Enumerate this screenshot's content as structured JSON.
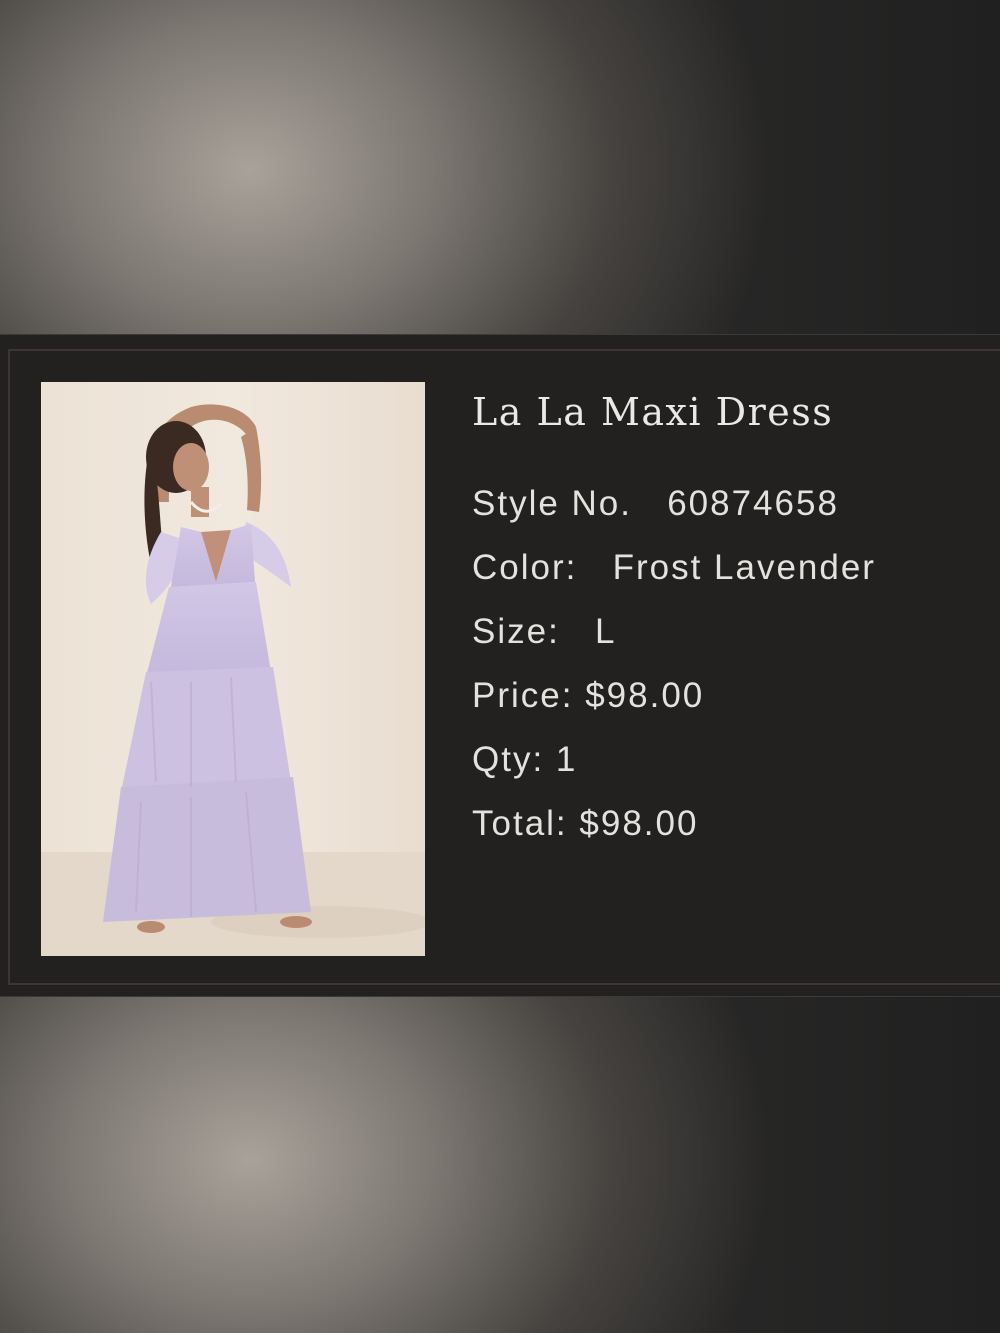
{
  "product": {
    "title": "La La Maxi Dress",
    "image_alt": "La La Maxi Dress in Frost Lavender",
    "style_label": "Style No.",
    "style_value": "60874658",
    "color_label": "Color:",
    "color_value": "Frost Lavender",
    "size_label": "Size:",
    "size_value": "L",
    "price_label": "Price:",
    "price_value": "$98.00",
    "qty_label": "Qty:",
    "qty_value": "1",
    "total_label": "Total:",
    "total_value": "$98.00"
  },
  "colors": {
    "card_bg": "#222120",
    "text": "#e4e2df",
    "dress": "#cbbfe0"
  }
}
